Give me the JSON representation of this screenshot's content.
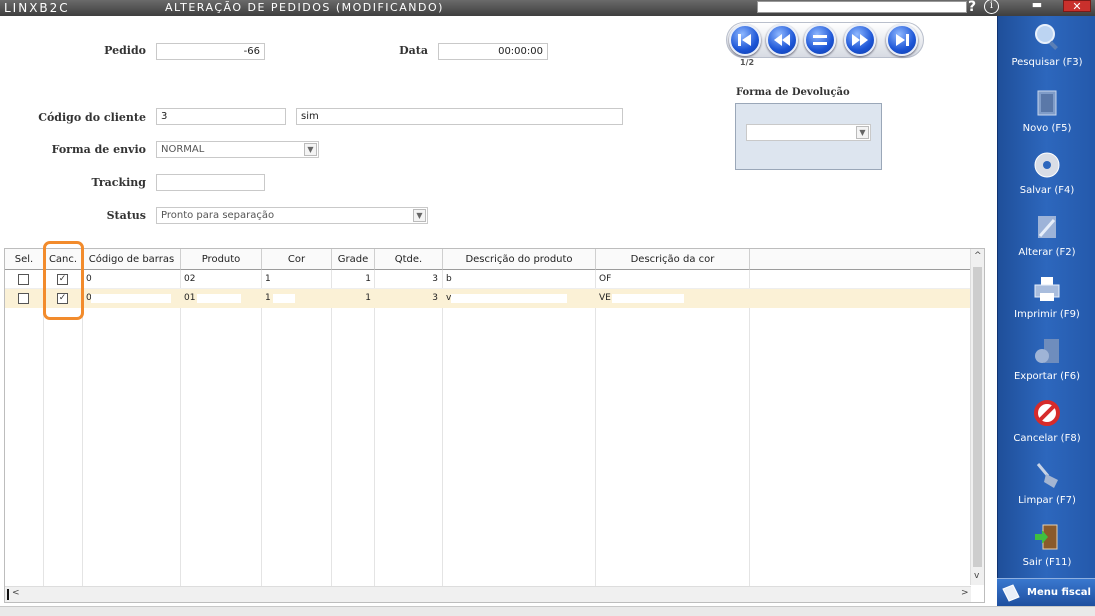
{
  "titlebar": {
    "app_name": "LINXB2C",
    "window_title": "ALTERAÇÃO DE PEDIDOS (MODIFICANDO)",
    "help": "?",
    "info": "i",
    "minimize": "▬",
    "close": "✕"
  },
  "form": {
    "pedido_label": "Pedido",
    "pedido_value": "-66",
    "data_label": "Data",
    "data_value": "00:00:00",
    "codigo_cliente_label": "Código do cliente",
    "codigo_cliente_value": "3",
    "cliente_nome_value": "sim",
    "forma_envio_label": "Forma de envio",
    "forma_envio_value": "NORMAL",
    "tracking_label": "Tracking",
    "tracking_value": "",
    "status_label": "Status",
    "status_value": "Pronto para separação"
  },
  "navigation": {
    "counter": "1/2",
    "buttons": [
      "first",
      "previous",
      "list",
      "next",
      "last"
    ]
  },
  "devolucao": {
    "title": "Forma de Devolução",
    "value": ""
  },
  "grid": {
    "columns": [
      "Sel.",
      "Canc.",
      "Código de barras",
      "Produto",
      "Cor",
      "Grade",
      "Qtde.",
      "Descrição do produto",
      "Descrição da cor"
    ],
    "rows": [
      {
        "sel": false,
        "canc": true,
        "codigo": "0",
        "produto": "02",
        "cor": "1",
        "grade": "1",
        "qtde": "3",
        "descricao": "b",
        "descricao_cor": "OF"
      },
      {
        "sel": false,
        "canc": true,
        "codigo": "0",
        "produto": "01",
        "cor": "1",
        "grade": "1",
        "qtde": "3",
        "descricao": "v",
        "descricao_cor": "VE"
      }
    ],
    "scroll_left": "<",
    "scroll_up": "^",
    "scroll_down": "v",
    "scroll_right": ">"
  },
  "sidebar": {
    "items": [
      {
        "label": "Pesquisar (F3)",
        "icon": "search-icon"
      },
      {
        "label": "Novo (F5)",
        "icon": "new-document-icon"
      },
      {
        "label": "Salvar (F4)",
        "icon": "save-disc-icon"
      },
      {
        "label": "Alterar (F2)",
        "icon": "edit-icon"
      },
      {
        "label": "Imprimir (F9)",
        "icon": "printer-icon"
      },
      {
        "label": "Exportar (F6)",
        "icon": "export-icon"
      },
      {
        "label": "Cancelar (F8)",
        "icon": "cancel-icon"
      },
      {
        "label": "Limpar (F7)",
        "icon": "broom-icon"
      },
      {
        "label": "Sair (F11)",
        "icon": "exit-door-icon"
      }
    ],
    "menu_fiscal": "Menu fiscal"
  },
  "colors": {
    "highlight": "#f28b2c",
    "sidebar": "#2d67bd",
    "selected_row": "#fbf1d6"
  }
}
